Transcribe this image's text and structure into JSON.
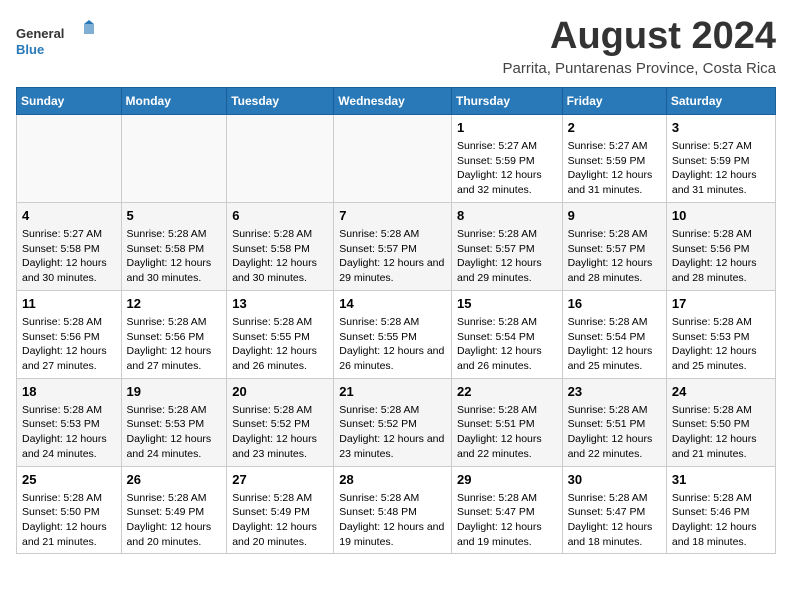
{
  "logo": {
    "general": "General",
    "blue": "Blue"
  },
  "title": "August 2024",
  "subtitle": "Parrita, Puntarenas Province, Costa Rica",
  "days_of_week": [
    "Sunday",
    "Monday",
    "Tuesday",
    "Wednesday",
    "Thursday",
    "Friday",
    "Saturday"
  ],
  "weeks": [
    [
      {
        "day": "",
        "content": ""
      },
      {
        "day": "",
        "content": ""
      },
      {
        "day": "",
        "content": ""
      },
      {
        "day": "",
        "content": ""
      },
      {
        "day": "1",
        "content": "Sunrise: 5:27 AM\nSunset: 5:59 PM\nDaylight: 12 hours and 32 minutes."
      },
      {
        "day": "2",
        "content": "Sunrise: 5:27 AM\nSunset: 5:59 PM\nDaylight: 12 hours and 31 minutes."
      },
      {
        "day": "3",
        "content": "Sunrise: 5:27 AM\nSunset: 5:59 PM\nDaylight: 12 hours and 31 minutes."
      }
    ],
    [
      {
        "day": "4",
        "content": "Sunrise: 5:27 AM\nSunset: 5:58 PM\nDaylight: 12 hours and 30 minutes."
      },
      {
        "day": "5",
        "content": "Sunrise: 5:28 AM\nSunset: 5:58 PM\nDaylight: 12 hours and 30 minutes."
      },
      {
        "day": "6",
        "content": "Sunrise: 5:28 AM\nSunset: 5:58 PM\nDaylight: 12 hours and 30 minutes."
      },
      {
        "day": "7",
        "content": "Sunrise: 5:28 AM\nSunset: 5:57 PM\nDaylight: 12 hours and 29 minutes."
      },
      {
        "day": "8",
        "content": "Sunrise: 5:28 AM\nSunset: 5:57 PM\nDaylight: 12 hours and 29 minutes."
      },
      {
        "day": "9",
        "content": "Sunrise: 5:28 AM\nSunset: 5:57 PM\nDaylight: 12 hours and 28 minutes."
      },
      {
        "day": "10",
        "content": "Sunrise: 5:28 AM\nSunset: 5:56 PM\nDaylight: 12 hours and 28 minutes."
      }
    ],
    [
      {
        "day": "11",
        "content": "Sunrise: 5:28 AM\nSunset: 5:56 PM\nDaylight: 12 hours and 27 minutes."
      },
      {
        "day": "12",
        "content": "Sunrise: 5:28 AM\nSunset: 5:56 PM\nDaylight: 12 hours and 27 minutes."
      },
      {
        "day": "13",
        "content": "Sunrise: 5:28 AM\nSunset: 5:55 PM\nDaylight: 12 hours and 26 minutes."
      },
      {
        "day": "14",
        "content": "Sunrise: 5:28 AM\nSunset: 5:55 PM\nDaylight: 12 hours and 26 minutes."
      },
      {
        "day": "15",
        "content": "Sunrise: 5:28 AM\nSunset: 5:54 PM\nDaylight: 12 hours and 26 minutes."
      },
      {
        "day": "16",
        "content": "Sunrise: 5:28 AM\nSunset: 5:54 PM\nDaylight: 12 hours and 25 minutes."
      },
      {
        "day": "17",
        "content": "Sunrise: 5:28 AM\nSunset: 5:53 PM\nDaylight: 12 hours and 25 minutes."
      }
    ],
    [
      {
        "day": "18",
        "content": "Sunrise: 5:28 AM\nSunset: 5:53 PM\nDaylight: 12 hours and 24 minutes."
      },
      {
        "day": "19",
        "content": "Sunrise: 5:28 AM\nSunset: 5:53 PM\nDaylight: 12 hours and 24 minutes."
      },
      {
        "day": "20",
        "content": "Sunrise: 5:28 AM\nSunset: 5:52 PM\nDaylight: 12 hours and 23 minutes."
      },
      {
        "day": "21",
        "content": "Sunrise: 5:28 AM\nSunset: 5:52 PM\nDaylight: 12 hours and 23 minutes."
      },
      {
        "day": "22",
        "content": "Sunrise: 5:28 AM\nSunset: 5:51 PM\nDaylight: 12 hours and 22 minutes."
      },
      {
        "day": "23",
        "content": "Sunrise: 5:28 AM\nSunset: 5:51 PM\nDaylight: 12 hours and 22 minutes."
      },
      {
        "day": "24",
        "content": "Sunrise: 5:28 AM\nSunset: 5:50 PM\nDaylight: 12 hours and 21 minutes."
      }
    ],
    [
      {
        "day": "25",
        "content": "Sunrise: 5:28 AM\nSunset: 5:50 PM\nDaylight: 12 hours and 21 minutes."
      },
      {
        "day": "26",
        "content": "Sunrise: 5:28 AM\nSunset: 5:49 PM\nDaylight: 12 hours and 20 minutes."
      },
      {
        "day": "27",
        "content": "Sunrise: 5:28 AM\nSunset: 5:49 PM\nDaylight: 12 hours and 20 minutes."
      },
      {
        "day": "28",
        "content": "Sunrise: 5:28 AM\nSunset: 5:48 PM\nDaylight: 12 hours and 19 minutes."
      },
      {
        "day": "29",
        "content": "Sunrise: 5:28 AM\nSunset: 5:47 PM\nDaylight: 12 hours and 19 minutes."
      },
      {
        "day": "30",
        "content": "Sunrise: 5:28 AM\nSunset: 5:47 PM\nDaylight: 12 hours and 18 minutes."
      },
      {
        "day": "31",
        "content": "Sunrise: 5:28 AM\nSunset: 5:46 PM\nDaylight: 12 hours and 18 minutes."
      }
    ]
  ]
}
